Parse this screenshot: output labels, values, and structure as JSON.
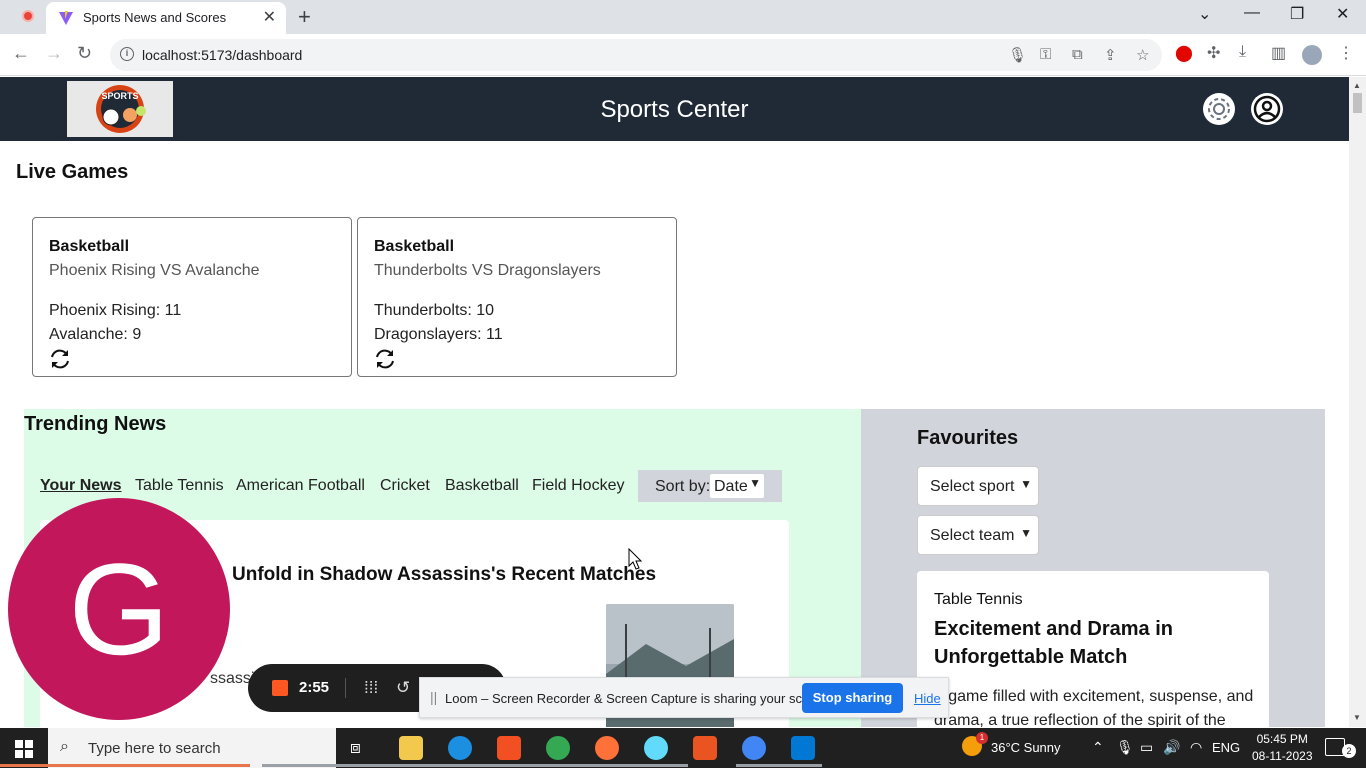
{
  "browser": {
    "tab_title": "Sports News and Scores",
    "new_tab": "+",
    "tab_close": "✕",
    "url": "localhost:5173/dashboard"
  },
  "app": {
    "title": "Sports Center",
    "logo_alt": "SPORTS"
  },
  "live_games": {
    "title": "Live Games",
    "games": [
      {
        "sport": "Basketball",
        "match": "Phoenix Rising VS Avalanche",
        "score1": "Phoenix Rising: 11",
        "score2": "Avalanche: 9"
      },
      {
        "sport": "Basketball",
        "match": "Thunderbolts VS Dragonslayers",
        "score1": "Thunderbolts: 10",
        "score2": "Dragonslayers: 11"
      }
    ]
  },
  "trending": {
    "title": "Trending News",
    "tabs": [
      "Your News",
      "Table Tennis",
      "American Football",
      "Cricket",
      "Basketball",
      "Field Hockey"
    ],
    "sort_label": "Sort by:",
    "sort_value": "Date",
    "article": {
      "headline": "Unfold in Shadow Assassins's Recent Matches",
      "snippet": "ssassin"
    }
  },
  "favourites": {
    "title": "Favourites",
    "sport_select": "Select sport",
    "team_select": "Select team",
    "card": {
      "sport": "Table Tennis",
      "headline": "Excitement and Drama in Unforgettable Match",
      "body": "A game filled with excitement, suspense, and drama, a true reflection of the spirit of the"
    }
  },
  "overlays": {
    "avatar_letter": "G",
    "loom_time": "2:55",
    "share_message": "Loom – Screen Recorder & Screen Capture is sharing your screen.",
    "stop_sharing": "Stop sharing",
    "hide": "Hide"
  },
  "taskbar": {
    "search_placeholder": "Type here to search",
    "weather": "36°C  Sunny",
    "weather_badge": "1",
    "language": "ENG",
    "time": "05:45 PM",
    "date": "08-11-2023",
    "notifications": "2"
  },
  "colors": {
    "header_bg": "#1f2a36",
    "trending_bg": "#dcfce7",
    "favourites_bg": "#d1d5db",
    "avatar_bg": "#c2185b",
    "loom_accent": "#ff5722",
    "stop_button": "#1a73e8"
  }
}
